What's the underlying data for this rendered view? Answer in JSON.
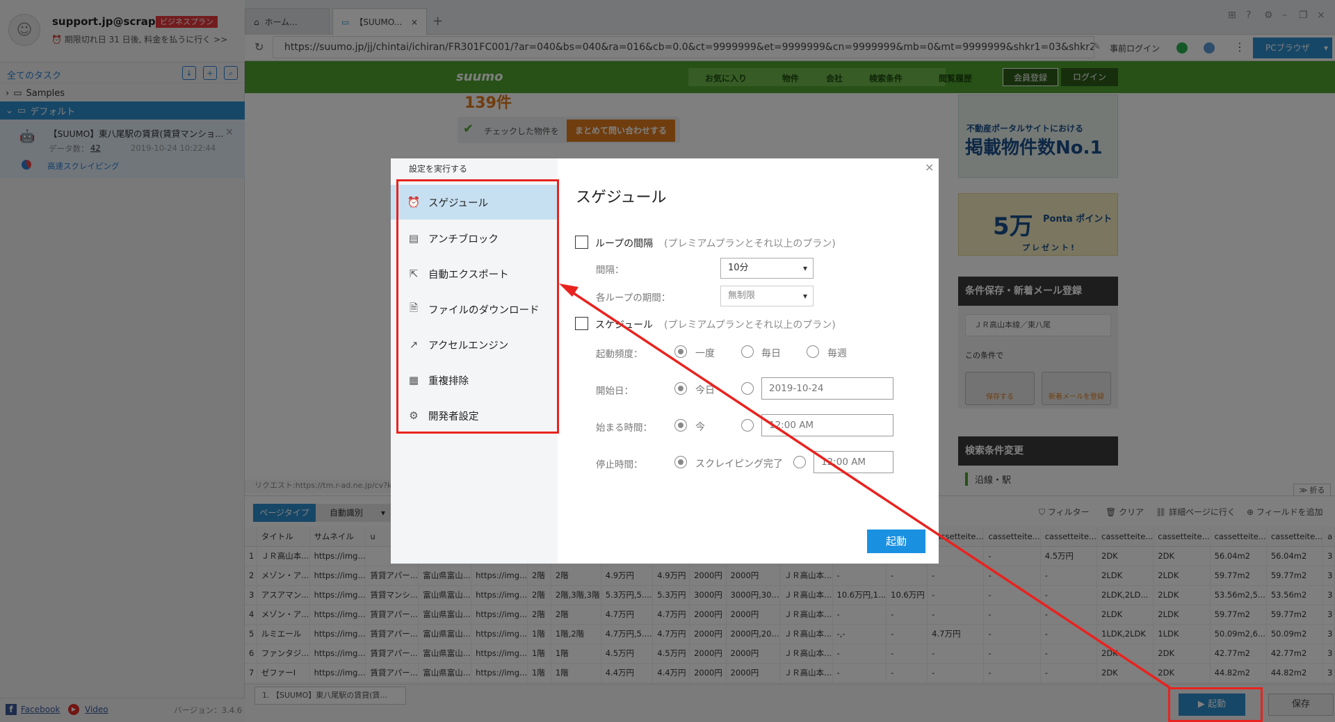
{
  "sidebar": {
    "account_email": "support.jp@scrap...",
    "plan_badge": "ビジネスプラン",
    "expiry_notice": "期限切れ日 31 日後, 料金を払うに行く >>",
    "all_tasks": "全てのタスク",
    "folders": [
      {
        "label": "Samples",
        "expanded": false
      },
      {
        "label": "デフォルト",
        "expanded": true
      }
    ],
    "task": {
      "title": "【SUUMO】東八尾駅の賃貸(賃貸マンショ...",
      "data_count_label": "データ数：",
      "data_count": "42",
      "date": "2019-10-24 10:22:44",
      "mode": "高速スクレイピング"
    },
    "footer": {
      "facebook": "Facebook",
      "video": "Video",
      "version": "バージョン：3.4.6"
    }
  },
  "browser": {
    "tabs": [
      {
        "label": "ホーム...",
        "active": false
      },
      {
        "label": "【SUUMO...",
        "active": true
      }
    ],
    "url": "https://suumo.jp/jj/chintai/ichiran/FR301FC001/?ar=040&bs=040&ra=016&cb=0.0&ct=9999999&et=9999999&cn=9999999&mb=0&mt=9999999&shkr1=03&shkr2...",
    "prelogin": "事前ログイン",
    "pc_browser": "PCブラウザ",
    "request_status": "リクエスト:https://tm.r-ad.ne.jp/cv?k=",
    "collapse": "折る"
  },
  "site": {
    "logo": "suumo",
    "nav": [
      "お気に入り",
      "物件",
      "会社",
      "検索条件",
      "閲覧履歴"
    ],
    "register": "会員登録",
    "login": "ログイン",
    "result_count_fragment": "139件",
    "checked_text": "チェックした物件を",
    "inquire_button": "まとめて問い合わせする",
    "ad1_line1": "不動産ポータルサイトにおける",
    "ad1_line2": "掲載物件数No.1",
    "ad2_big": "5万",
    "ad2_small": "Ponta ポイント",
    "ad2_present": "プレゼント!",
    "save_conditions": "条件保存・新着メール登録",
    "route": "ＪＲ高山本線／東八尾",
    "this_condition": "この条件で",
    "save_btn": "保存する",
    "mail_btn": "新着メールを登録",
    "search_change": "検索条件変更",
    "ensen": "沿線・駅"
  },
  "data_panel": {
    "page_type": "ページタイプ",
    "auto_detect": "自動識別",
    "tools": [
      "フィルター",
      "クリア",
      "詳細ページに行く",
      "フィールドを追加"
    ],
    "columns": [
      "",
      "タイトル",
      "サムネイル",
      "u",
      "",
      "",
      "",
      "",
      "",
      "",
      "",
      "",
      "",
      "",
      "",
      "cassetteite...",
      "cassetteite...",
      "cassetteite...",
      "cassetteite...",
      "cassetteite...",
      "cassetteite...",
      "cassetteite...",
      "a"
    ],
    "rows": [
      [
        "1",
        "ＪＲ高山本...",
        "https://img...",
        "",
        "",
        "",
        "",
        "",
        "",
        "",
        "",
        "",
        "",
        "",
        "",
        "-",
        "-",
        "4.5万円",
        "2DK",
        "2DK",
        "56.04m2",
        "56.04m2",
        "3"
      ],
      [
        "2",
        "メゾン・ア...",
        "https://img...",
        "賃貸アパー...",
        "富山県富山...",
        "https://img...",
        "2階",
        "2階",
        "4.9万円",
        "4.9万円",
        "2000円",
        "2000円",
        "ＪＲ高山本...",
        "-",
        "-",
        "-",
        "-",
        "-",
        "2LDK",
        "2LDK",
        "59.77m2",
        "59.77m2",
        "3"
      ],
      [
        "3",
        "アスアマン...",
        "https://img...",
        "賃貸マンシ...",
        "富山県富山...",
        "https://img...",
        "2階",
        "2階,3階,3階",
        "5.3万円,5....",
        "5.3万円",
        "3000円",
        "3000円,30...",
        "ＪＲ高山本...",
        "10.6万円,1...",
        "10.6万円",
        "-",
        "-",
        "-",
        "2LDK,2LD...",
        "2LDK",
        "53.56m2,5...",
        "53.56m2",
        "3"
      ],
      [
        "4",
        "メゾン・ア...",
        "https://img...",
        "賃貸アパー...",
        "富山県富山...",
        "https://img...",
        "2階",
        "2階",
        "4.7万円",
        "4.7万円",
        "2000円",
        "2000円",
        "ＪＲ高山本...",
        "-",
        "-",
        "-",
        "-",
        "-",
        "2LDK",
        "2LDK",
        "59.77m2",
        "59.77m2",
        "3"
      ],
      [
        "5",
        "ルミエール",
        "https://img...",
        "賃貸アパー...",
        "富山県富山...",
        "https://img...",
        "1階",
        "1階,2階",
        "4.7万円,5....",
        "4.7万円",
        "2000円",
        "2000円,20...",
        "ＪＲ高山本...",
        "-,-",
        "-",
        "4.7万円",
        "-",
        "-",
        "1LDK,2LDK",
        "1LDK",
        "50.09m2,6...",
        "50.09m2",
        "3"
      ],
      [
        "6",
        "ファンタジ...",
        "https://img...",
        "賃貸アパー...",
        "富山県富山...",
        "https://img...",
        "1階",
        "1階",
        "4.5万円",
        "4.5万円",
        "2000円",
        "2000円",
        "ＪＲ高山本...",
        "-",
        "-",
        "-",
        "-",
        "-",
        "2DK",
        "2DK",
        "42.77m2",
        "42.77m2",
        "3"
      ],
      [
        "7",
        "ゼファーI",
        "https://img...",
        "賃貸アパー...",
        "富山県富山...",
        "https://img...",
        "1階",
        "1階",
        "4.4万円",
        "4.4万円",
        "2000円",
        "2000円",
        "ＪＲ高山本...",
        "-",
        "-",
        "-",
        "-",
        "-",
        "2DK",
        "2DK",
        "44.82m2",
        "44.82m2",
        "3"
      ]
    ]
  },
  "bottom": {
    "task_tab": "1. 【SUUMO】東八尾駅の賃貸(賃...",
    "start": "起動",
    "save": "保存"
  },
  "modal": {
    "caption": "設定を実行する",
    "menu": [
      {
        "label": "スゲジュール",
        "icon": "alarm-clock-icon",
        "active": true
      },
      {
        "label": "アンチブロック",
        "icon": "shield-list-icon",
        "active": false
      },
      {
        "label": "自動エクスポート",
        "icon": "export-icon",
        "active": false
      },
      {
        "label": "ファイルのダウンロード",
        "icon": "file-download-icon",
        "active": false
      },
      {
        "label": "アクセルエンジン",
        "icon": "chart-up-icon",
        "active": false
      },
      {
        "label": "重複排除",
        "icon": "dedupe-icon",
        "active": false
      },
      {
        "label": "開発者設定",
        "icon": "gear-icon",
        "active": false
      }
    ],
    "title": "スゲジュール",
    "loop": {
      "label": "ループの間隔",
      "note": "(プレミアムプランとそれ以上のプラン)",
      "interval_label": "間隔：",
      "interval_value": "10分",
      "period_label": "各ループの期間：",
      "period_value": "無制限"
    },
    "schedule": {
      "label": "スケジュール",
      "note": "(プレミアムプランとそれ以上のプラン)",
      "freq_label": "起動頻度：",
      "freq_options": [
        "一度",
        "毎日",
        "毎週"
      ],
      "start_date_label": "開始日：",
      "today": "今日",
      "start_date_value": "2019-10-24",
      "start_time_label": "始まる時間：",
      "now": "今",
      "start_time_value": "12:00 AM",
      "stop_time_label": "停止時間：",
      "scrape_done": "スクレイピング完了",
      "stop_time_value": "12:00 AM"
    },
    "start_button": "起動"
  }
}
